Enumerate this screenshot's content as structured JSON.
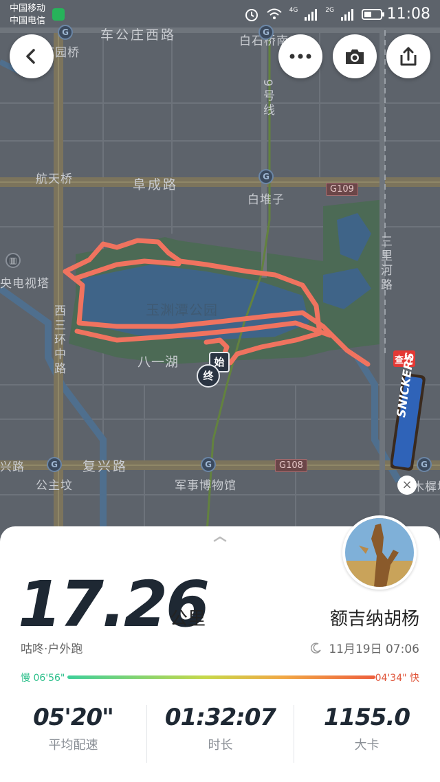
{
  "status_bar": {
    "carrier_1": "中国移动",
    "carrier_2": "中国电信",
    "network_1": "4G",
    "network_2": "2G",
    "time": "11:08"
  },
  "map": {
    "labels": {
      "road_top": "车公庄西路",
      "bridge_top_left": "花园桥",
      "bridge_top_right": "白石桥南",
      "metro_line": "9号线",
      "hangtian_bridge": "航天桥",
      "fucheng_road": "阜成路",
      "baiduizi": "白堆子",
      "cctv_tower": "央电视塔",
      "sanlihe_road": "三里河路",
      "park_name": "玉渊潭公园",
      "bayi_lake": "八一湖",
      "west_3rd_ring": "西三环中路",
      "fuxing_road_left": "兴路",
      "fuxing_road": "复兴路",
      "gongzhufen": "公主坟",
      "military_museum": "军事博物馆",
      "muxidi": "木樨地"
    },
    "shields": {
      "g109": "G109",
      "g108": "G108"
    },
    "markers": {
      "start": "始",
      "end": "终"
    },
    "route_color": "#f0735f",
    "ad": {
      "brand": "SNICKERS",
      "tag": "查分"
    }
  },
  "toolbar": {
    "back_icon": "back-arrow-icon",
    "more_icon": "more-dots-icon",
    "camera_icon": "camera-icon",
    "share_icon": "share-icon"
  },
  "summary": {
    "distance": "17.26",
    "distance_unit": "公里",
    "username": "额吉纳胡杨",
    "activity_type": "咕咚·户外跑",
    "date_time": "11月19日 07:06",
    "pace_slow_label": "慢 06'56\"",
    "pace_fast_label": "04'34\" 快"
  },
  "stats": [
    {
      "value": "05'20\"",
      "label": "平均配速"
    },
    {
      "value": "01:32:07",
      "label": "时长"
    },
    {
      "value": "1155.0",
      "label": "大卡"
    }
  ],
  "colors": {
    "pace_slow": "#2bbf8a",
    "pace_fast": "#e0553a",
    "primary_text": "#1e2833"
  }
}
